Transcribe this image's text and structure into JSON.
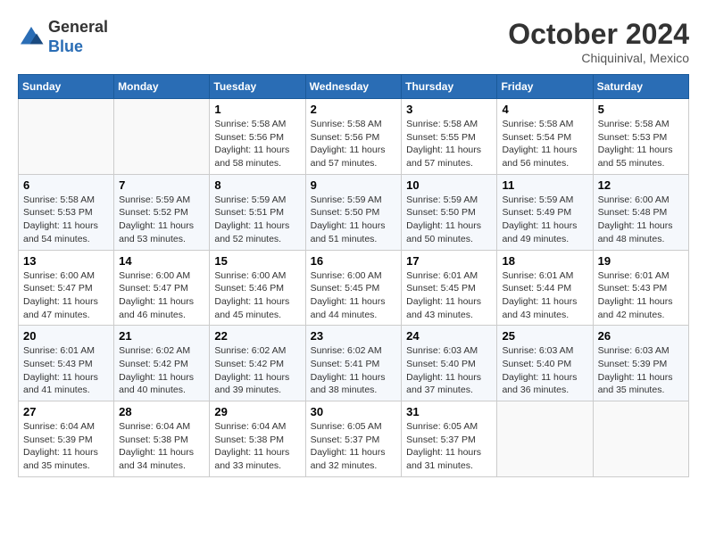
{
  "header": {
    "logo_line1": "General",
    "logo_line2": "Blue",
    "month": "October 2024",
    "location": "Chiquinival, Mexico"
  },
  "days_of_week": [
    "Sunday",
    "Monday",
    "Tuesday",
    "Wednesday",
    "Thursday",
    "Friday",
    "Saturday"
  ],
  "weeks": [
    [
      {
        "day": "",
        "sunrise": "",
        "sunset": "",
        "daylight": ""
      },
      {
        "day": "",
        "sunrise": "",
        "sunset": "",
        "daylight": ""
      },
      {
        "day": "1",
        "sunrise": "Sunrise: 5:58 AM",
        "sunset": "Sunset: 5:56 PM",
        "daylight": "Daylight: 11 hours and 58 minutes."
      },
      {
        "day": "2",
        "sunrise": "Sunrise: 5:58 AM",
        "sunset": "Sunset: 5:56 PM",
        "daylight": "Daylight: 11 hours and 57 minutes."
      },
      {
        "day": "3",
        "sunrise": "Sunrise: 5:58 AM",
        "sunset": "Sunset: 5:55 PM",
        "daylight": "Daylight: 11 hours and 57 minutes."
      },
      {
        "day": "4",
        "sunrise": "Sunrise: 5:58 AM",
        "sunset": "Sunset: 5:54 PM",
        "daylight": "Daylight: 11 hours and 56 minutes."
      },
      {
        "day": "5",
        "sunrise": "Sunrise: 5:58 AM",
        "sunset": "Sunset: 5:53 PM",
        "daylight": "Daylight: 11 hours and 55 minutes."
      }
    ],
    [
      {
        "day": "6",
        "sunrise": "Sunrise: 5:58 AM",
        "sunset": "Sunset: 5:53 PM",
        "daylight": "Daylight: 11 hours and 54 minutes."
      },
      {
        "day": "7",
        "sunrise": "Sunrise: 5:59 AM",
        "sunset": "Sunset: 5:52 PM",
        "daylight": "Daylight: 11 hours and 53 minutes."
      },
      {
        "day": "8",
        "sunrise": "Sunrise: 5:59 AM",
        "sunset": "Sunset: 5:51 PM",
        "daylight": "Daylight: 11 hours and 52 minutes."
      },
      {
        "day": "9",
        "sunrise": "Sunrise: 5:59 AM",
        "sunset": "Sunset: 5:50 PM",
        "daylight": "Daylight: 11 hours and 51 minutes."
      },
      {
        "day": "10",
        "sunrise": "Sunrise: 5:59 AM",
        "sunset": "Sunset: 5:50 PM",
        "daylight": "Daylight: 11 hours and 50 minutes."
      },
      {
        "day": "11",
        "sunrise": "Sunrise: 5:59 AM",
        "sunset": "Sunset: 5:49 PM",
        "daylight": "Daylight: 11 hours and 49 minutes."
      },
      {
        "day": "12",
        "sunrise": "Sunrise: 6:00 AM",
        "sunset": "Sunset: 5:48 PM",
        "daylight": "Daylight: 11 hours and 48 minutes."
      }
    ],
    [
      {
        "day": "13",
        "sunrise": "Sunrise: 6:00 AM",
        "sunset": "Sunset: 5:47 PM",
        "daylight": "Daylight: 11 hours and 47 minutes."
      },
      {
        "day": "14",
        "sunrise": "Sunrise: 6:00 AM",
        "sunset": "Sunset: 5:47 PM",
        "daylight": "Daylight: 11 hours and 46 minutes."
      },
      {
        "day": "15",
        "sunrise": "Sunrise: 6:00 AM",
        "sunset": "Sunset: 5:46 PM",
        "daylight": "Daylight: 11 hours and 45 minutes."
      },
      {
        "day": "16",
        "sunrise": "Sunrise: 6:00 AM",
        "sunset": "Sunset: 5:45 PM",
        "daylight": "Daylight: 11 hours and 44 minutes."
      },
      {
        "day": "17",
        "sunrise": "Sunrise: 6:01 AM",
        "sunset": "Sunset: 5:45 PM",
        "daylight": "Daylight: 11 hours and 43 minutes."
      },
      {
        "day": "18",
        "sunrise": "Sunrise: 6:01 AM",
        "sunset": "Sunset: 5:44 PM",
        "daylight": "Daylight: 11 hours and 43 minutes."
      },
      {
        "day": "19",
        "sunrise": "Sunrise: 6:01 AM",
        "sunset": "Sunset: 5:43 PM",
        "daylight": "Daylight: 11 hours and 42 minutes."
      }
    ],
    [
      {
        "day": "20",
        "sunrise": "Sunrise: 6:01 AM",
        "sunset": "Sunset: 5:43 PM",
        "daylight": "Daylight: 11 hours and 41 minutes."
      },
      {
        "day": "21",
        "sunrise": "Sunrise: 6:02 AM",
        "sunset": "Sunset: 5:42 PM",
        "daylight": "Daylight: 11 hours and 40 minutes."
      },
      {
        "day": "22",
        "sunrise": "Sunrise: 6:02 AM",
        "sunset": "Sunset: 5:42 PM",
        "daylight": "Daylight: 11 hours and 39 minutes."
      },
      {
        "day": "23",
        "sunrise": "Sunrise: 6:02 AM",
        "sunset": "Sunset: 5:41 PM",
        "daylight": "Daylight: 11 hours and 38 minutes."
      },
      {
        "day": "24",
        "sunrise": "Sunrise: 6:03 AM",
        "sunset": "Sunset: 5:40 PM",
        "daylight": "Daylight: 11 hours and 37 minutes."
      },
      {
        "day": "25",
        "sunrise": "Sunrise: 6:03 AM",
        "sunset": "Sunset: 5:40 PM",
        "daylight": "Daylight: 11 hours and 36 minutes."
      },
      {
        "day": "26",
        "sunrise": "Sunrise: 6:03 AM",
        "sunset": "Sunset: 5:39 PM",
        "daylight": "Daylight: 11 hours and 35 minutes."
      }
    ],
    [
      {
        "day": "27",
        "sunrise": "Sunrise: 6:04 AM",
        "sunset": "Sunset: 5:39 PM",
        "daylight": "Daylight: 11 hours and 35 minutes."
      },
      {
        "day": "28",
        "sunrise": "Sunrise: 6:04 AM",
        "sunset": "Sunset: 5:38 PM",
        "daylight": "Daylight: 11 hours and 34 minutes."
      },
      {
        "day": "29",
        "sunrise": "Sunrise: 6:04 AM",
        "sunset": "Sunset: 5:38 PM",
        "daylight": "Daylight: 11 hours and 33 minutes."
      },
      {
        "day": "30",
        "sunrise": "Sunrise: 6:05 AM",
        "sunset": "Sunset: 5:37 PM",
        "daylight": "Daylight: 11 hours and 32 minutes."
      },
      {
        "day": "31",
        "sunrise": "Sunrise: 6:05 AM",
        "sunset": "Sunset: 5:37 PM",
        "daylight": "Daylight: 11 hours and 31 minutes."
      },
      {
        "day": "",
        "sunrise": "",
        "sunset": "",
        "daylight": ""
      },
      {
        "day": "",
        "sunrise": "",
        "sunset": "",
        "daylight": ""
      }
    ]
  ]
}
